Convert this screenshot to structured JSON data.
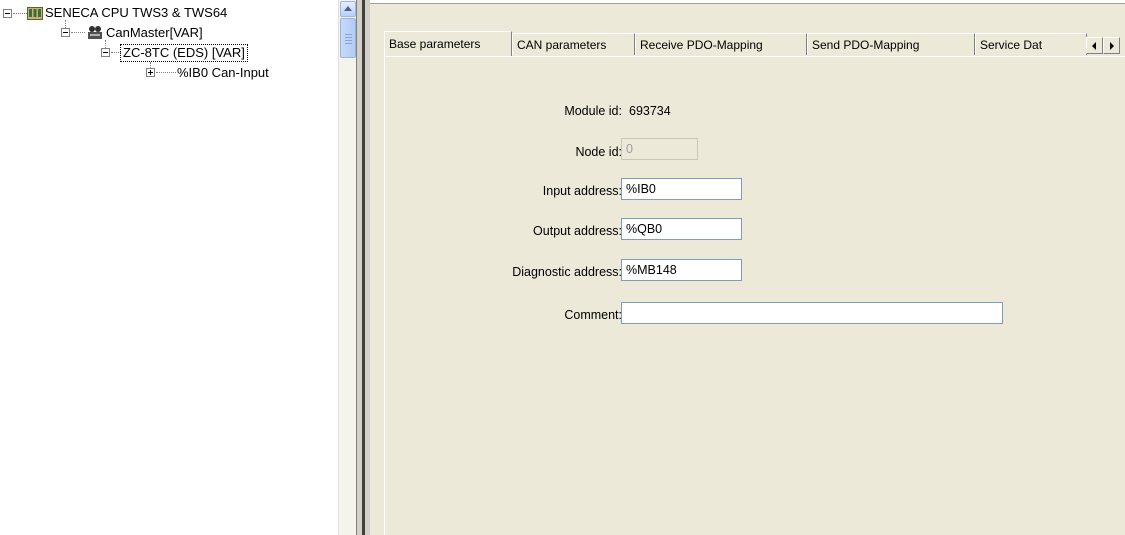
{
  "tree": {
    "root_label": "SENECA CPU TWS3 & TWS64",
    "master_label": "CanMaster[VAR]",
    "module_label": "ZC-8TC (EDS)  [VAR]",
    "input_label": "%IB0 Can-Input"
  },
  "tabs": [
    {
      "label": "Base parameters"
    },
    {
      "label": "CAN parameters"
    },
    {
      "label": "Receive PDO-Mapping"
    },
    {
      "label": "Send PDO-Mapping"
    },
    {
      "label": "Service Dat"
    }
  ],
  "form": {
    "module_id_label": "Module id:",
    "module_id_value": "693734",
    "node_id_label": "Node id:",
    "node_id_value": "0",
    "input_address_label": "Input address:",
    "input_address_value": "%IB0",
    "output_address_label": "Output address:",
    "output_address_value": "%QB0",
    "diagnostic_address_label": "Diagnostic address:",
    "diagnostic_address_value": "%MB148",
    "comment_label": "Comment:",
    "comment_value": ""
  }
}
